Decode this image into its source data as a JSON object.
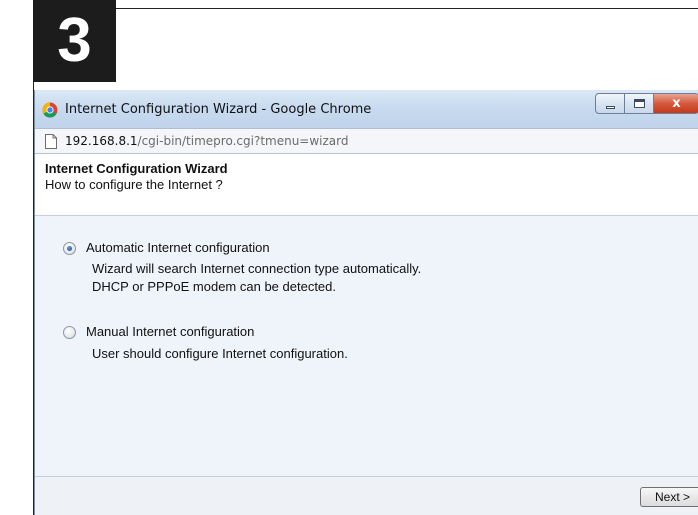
{
  "step": {
    "number": "3"
  },
  "window": {
    "title": "Internet Configuration Wizard - Google Chrome",
    "controls": {
      "close": "x"
    }
  },
  "address": {
    "host": "192.168.8.1",
    "path": "/cgi-bin/timepro.cgi?tmenu=wizard"
  },
  "wizard": {
    "title": "Internet Configuration Wizard",
    "subtitle": "How to configure the Internet ?",
    "options": [
      {
        "label": "Automatic Internet configuration",
        "selected": true,
        "description": [
          "Wizard will search Internet connection type automatically.",
          "DHCP or PPPoE modem can be detected."
        ]
      },
      {
        "label": "Manual Internet configuration",
        "selected": false,
        "description": [
          "User should configure Internet configuration."
        ]
      }
    ],
    "next_label": "Next >"
  },
  "icons": {
    "browser": "chrome-icon",
    "page": "page-icon",
    "minimize": "minimize-icon",
    "maximize": "maximize-icon",
    "close": "close-icon"
  },
  "colors": {
    "badge": "#1c1c1c",
    "titlebar": "#c7daef",
    "close_button": "#c4391b",
    "wizard_body": "#eff3fa",
    "url_path": "#6b6b6b"
  }
}
